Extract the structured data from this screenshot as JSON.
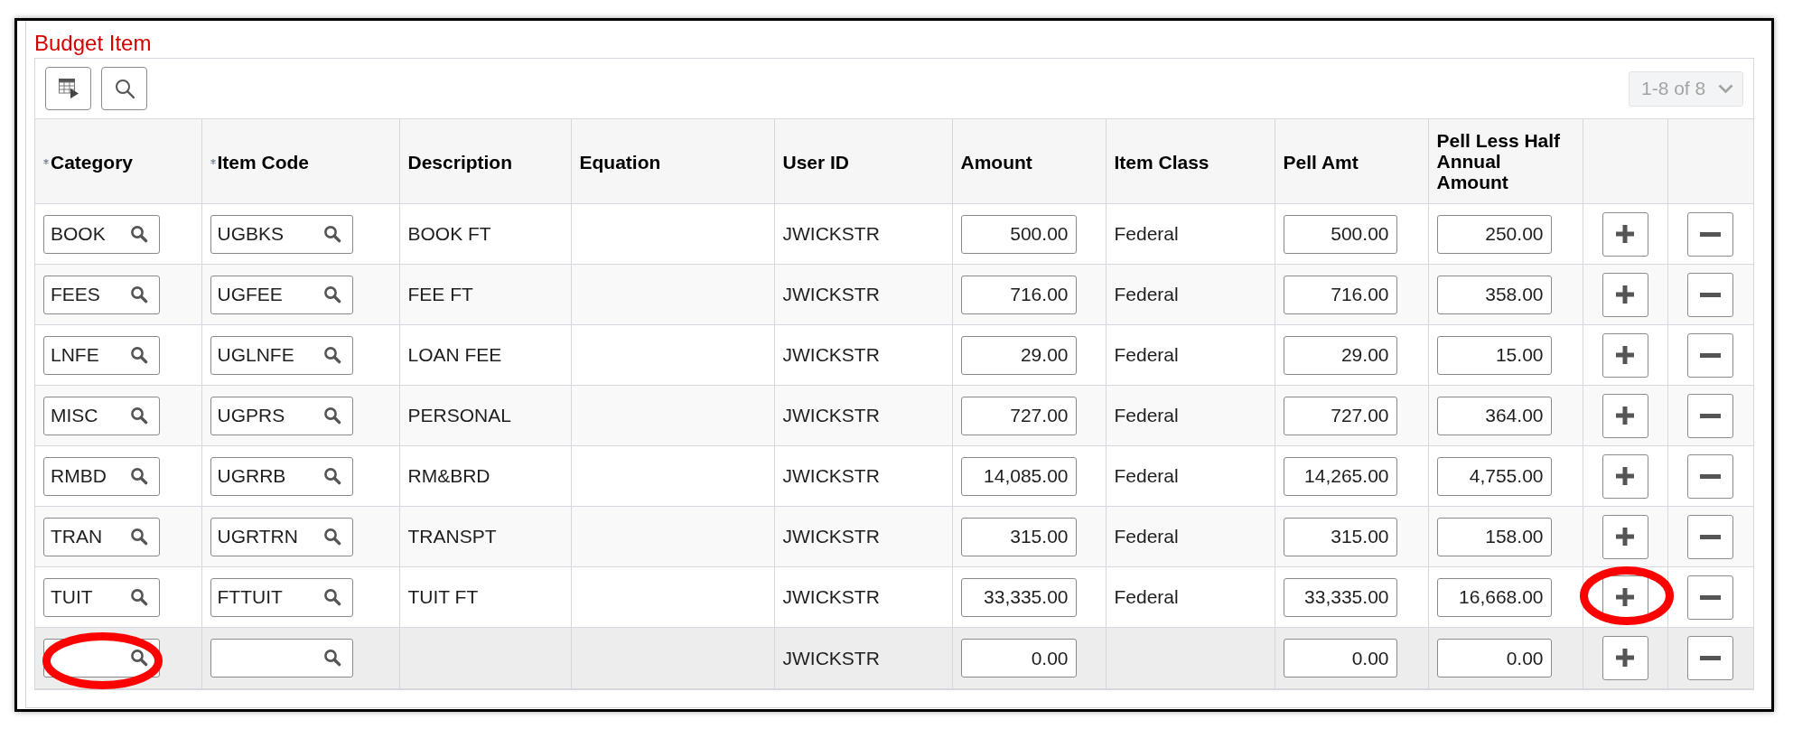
{
  "section": {
    "title": "Budget Item"
  },
  "pagination": {
    "label": "1-8 of 8",
    "disabled": true
  },
  "columns": [
    {
      "label": "Category",
      "kind": "lookup",
      "required": true
    },
    {
      "label": "Item Code",
      "kind": "lookup",
      "required": true
    },
    {
      "label": "Description",
      "kind": "text",
      "required": false
    },
    {
      "label": "Equation",
      "kind": "text",
      "required": false
    },
    {
      "label": "User ID",
      "kind": "text",
      "required": false
    },
    {
      "label": "Amount",
      "kind": "amount",
      "required": false
    },
    {
      "label": "Item Class",
      "kind": "text",
      "required": false
    },
    {
      "label": "Pell Amt",
      "kind": "amount",
      "required": false
    },
    {
      "label": "Pell Less Half Annual Amount",
      "kind": "amount",
      "required": false
    }
  ],
  "rows": [
    {
      "category": "BOOK",
      "item_code": "UGBKS",
      "description": "BOOK FT",
      "user_id": "JWICKSTR",
      "amount": "500.00",
      "item_class": "Federal",
      "pell_amt": "500.00",
      "pell_less_half_annual_amount": "250.00",
      "selected": false,
      "category_circled": false,
      "add_circled": false
    },
    {
      "category": "FEES",
      "item_code": "UGFEE",
      "description": "FEE FT",
      "user_id": "JWICKSTR",
      "amount": "716.00",
      "item_class": "Federal",
      "pell_amt": "716.00",
      "pell_less_half_annual_amount": "358.00",
      "selected": false,
      "category_circled": false,
      "add_circled": false
    },
    {
      "category": "LNFE",
      "item_code": "UGLNFE",
      "description": "LOAN FEE",
      "user_id": "JWICKSTR",
      "amount": "29.00",
      "item_class": "Federal",
      "pell_amt": "29.00",
      "pell_less_half_annual_amount": "15.00",
      "selected": false,
      "category_circled": false,
      "add_circled": false
    },
    {
      "category": "MISC",
      "item_code": "UGPRS",
      "description": "PERSONAL",
      "user_id": "JWICKSTR",
      "amount": "727.00",
      "item_class": "Federal",
      "pell_amt": "727.00",
      "pell_less_half_annual_amount": "364.00",
      "selected": false,
      "category_circled": false,
      "add_circled": false
    },
    {
      "category": "RMBD",
      "item_code": "UGRRB",
      "description": "RM&BRD",
      "user_id": "JWICKSTR",
      "amount": "14,085.00",
      "item_class": "Federal",
      "pell_amt": "14,265.00",
      "pell_less_half_annual_amount": "4,755.00",
      "selected": false,
      "category_circled": false,
      "add_circled": false
    },
    {
      "category": "TRAN",
      "item_code": "UGRTRN",
      "description": "TRANSPT",
      "user_id": "JWICKSTR",
      "amount": "315.00",
      "item_class": "Federal",
      "pell_amt": "315.00",
      "pell_less_half_annual_amount": "158.00",
      "selected": false,
      "category_circled": false,
      "add_circled": false
    },
    {
      "category": "TUIT",
      "item_code": "FTTUIT",
      "description": "TUIT FT",
      "user_id": "JWICKSTR",
      "amount": "33,335.00",
      "item_class": "Federal",
      "pell_amt": "33,335.00",
      "pell_less_half_annual_amount": "16,668.00",
      "selected": false,
      "category_circled": false,
      "add_circled": true
    },
    {
      "user_id": "JWICKSTR",
      "amount": "0.00",
      "pell_amt": "0.00",
      "pell_less_half_annual_amount": "0.00",
      "selected": true,
      "category_circled": true,
      "add_circled": false
    }
  ]
}
